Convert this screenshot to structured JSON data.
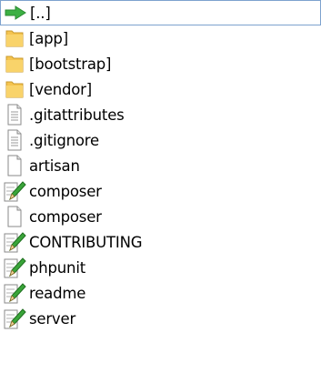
{
  "files": [
    {
      "name": "[..]",
      "icon": "up-arrow-icon",
      "selected": true
    },
    {
      "name": "[app]",
      "icon": "folder-icon"
    },
    {
      "name": "[bootstrap]",
      "icon": "folder-icon"
    },
    {
      "name": "[vendor]",
      "icon": "folder-icon"
    },
    {
      "name": ".gitattributes",
      "icon": "text-file-icon"
    },
    {
      "name": ".gitignore",
      "icon": "text-file-icon"
    },
    {
      "name": "artisan",
      "icon": "blank-file-icon"
    },
    {
      "name": "composer",
      "icon": "editable-file-icon"
    },
    {
      "name": "composer",
      "icon": "blank-file-icon"
    },
    {
      "name": "CONTRIBUTING",
      "icon": "editable-file-icon"
    },
    {
      "name": "phpunit",
      "icon": "editable-file-icon"
    },
    {
      "name": "readme",
      "icon": "editable-file-icon"
    },
    {
      "name": "server",
      "icon": "editable-file-icon"
    }
  ],
  "colors": {
    "selection_border": "#7da2ce",
    "arrow": "#3cb043",
    "folder": "#f5c44f",
    "pencil": "#2f9e2f"
  }
}
